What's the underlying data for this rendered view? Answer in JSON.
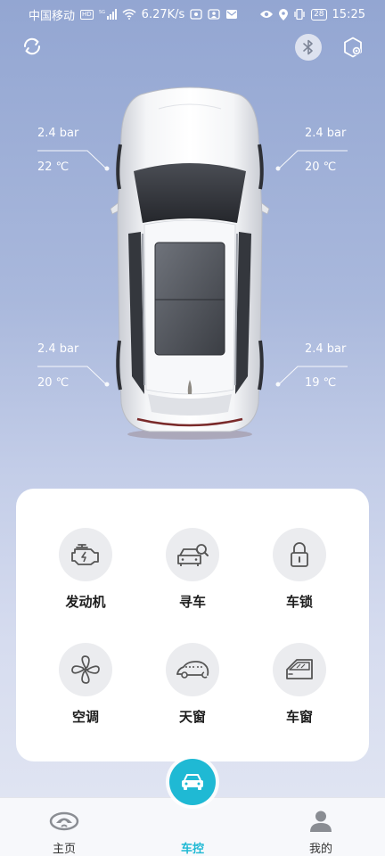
{
  "status_bar": {
    "carrier": "中国移动",
    "hd_badge": "HD",
    "network_badge": "5G",
    "speed": "6.27K/s",
    "battery": "28",
    "time": "15:25"
  },
  "header": {
    "icons": [
      "refresh-icon",
      "bluetooth-icon",
      "settings-icon"
    ]
  },
  "tires": {
    "front_left": {
      "pressure": "2.4 bar",
      "temperature": "22 ℃"
    },
    "front_right": {
      "pressure": "2.4 bar",
      "temperature": "20 ℃"
    },
    "rear_left": {
      "pressure": "2.4 bar",
      "temperature": "20 ℃"
    },
    "rear_right": {
      "pressure": "2.4 bar",
      "temperature": "19 ℃"
    }
  },
  "controls": [
    {
      "label": "发动机",
      "icon": "engine-icon"
    },
    {
      "label": "寻车",
      "icon": "find-car-icon"
    },
    {
      "label": "车锁",
      "icon": "lock-icon"
    },
    {
      "label": "空调",
      "icon": "fan-icon"
    },
    {
      "label": "天窗",
      "icon": "sunroof-icon"
    },
    {
      "label": "车窗",
      "icon": "window-icon"
    }
  ],
  "bottom_nav": {
    "items": [
      {
        "label": "主页",
        "icon": "brand-logo-icon",
        "active": false
      },
      {
        "label": "车控",
        "icon": "car-icon",
        "active": true
      },
      {
        "label": "我的",
        "icon": "person-icon",
        "active": false
      }
    ]
  },
  "colors": {
    "accent": "#1fb9d4",
    "background_top": "#93a6d2",
    "background_bottom": "#e3e7f3",
    "card": "#ffffff",
    "icon_circle": "#ebecef"
  }
}
